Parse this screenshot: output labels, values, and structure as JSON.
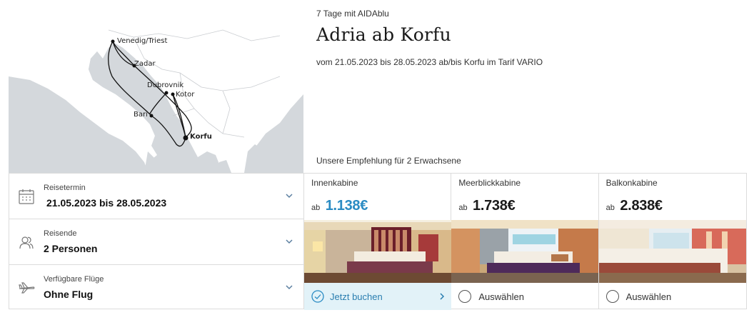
{
  "trip": {
    "duration_ship": "7 Tage mit AIDAblu",
    "title": "Adria ab Korfu",
    "dates_line": "vom 21.05.2023 bis 28.05.2023 ab/bis Korfu im Tarif VARIO"
  },
  "recommendation": "Unsere Empfehlung für 2 Erwachsene",
  "map": {
    "ports": [
      "Venedig/Triest",
      "Zadar",
      "Dubrovnik",
      "Kotor",
      "Bari",
      "Korfu"
    ],
    "home_port": "Korfu"
  },
  "form": {
    "date": {
      "label": "Reisetermin",
      "value": "21.05.2023 bis 28.05.2023",
      "icon": "calendar-icon"
    },
    "travellers": {
      "label": "Reisende",
      "value": "2 Personen",
      "icon": "users-icon"
    },
    "flights": {
      "label": "Verfügbare Flüge",
      "value": "Ohne Flug",
      "icon": "plane-icon"
    }
  },
  "cabins": [
    {
      "name": "Innenkabine",
      "prefix": "ab",
      "price": "1.138€",
      "action": "Jetzt buchen",
      "selected": true
    },
    {
      "name": "Meerblickkabine",
      "prefix": "ab",
      "price": "1.738€",
      "action": "Auswählen",
      "selected": false
    },
    {
      "name": "Balkonkabine",
      "prefix": "ab",
      "price": "2.838€",
      "action": "Auswählen",
      "selected": false
    }
  ],
  "colors": {
    "accent": "#2a8bc3",
    "selected_bg": "#e2f2f8",
    "map_sea": "#d4d8dc",
    "map_land": "#ffffff"
  }
}
